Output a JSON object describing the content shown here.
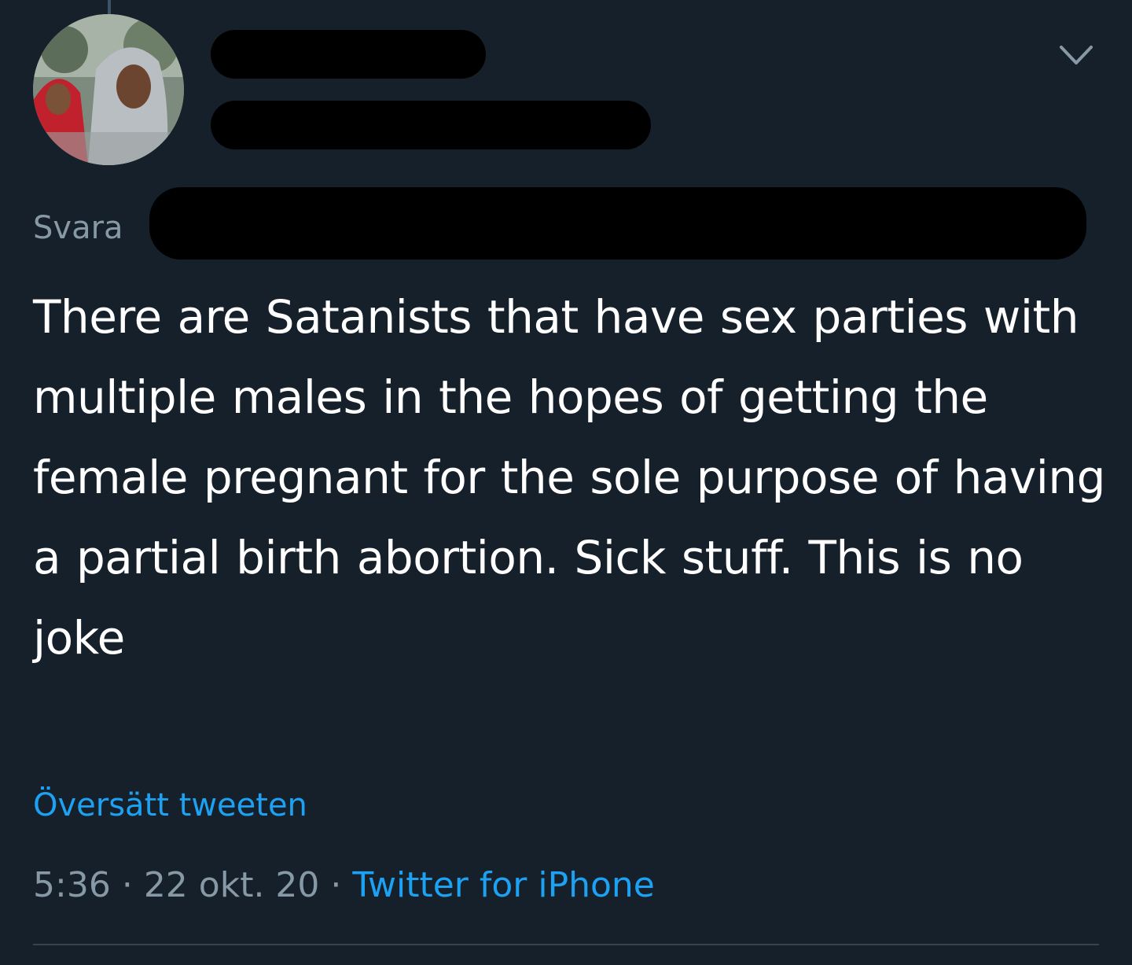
{
  "tweet": {
    "reply_prefix": "Svara",
    "text": "There are Satanists that have sex parties with multiple males in the hopes of getting the female pregnant for the sole purpose of having a partial birth abortion. Sick stuff. This is no joke",
    "translate_label": "Översätt tweeten",
    "time": "5:36",
    "date": "22 okt. 20",
    "separator": "·",
    "source": "Twitter for iPhone"
  },
  "icons": {
    "menu": "chevron-down-icon"
  },
  "colors": {
    "background": "#15202b",
    "text": "#ffffff",
    "muted": "#8899a6",
    "link": "#1da1f2",
    "redaction": "#000000"
  }
}
